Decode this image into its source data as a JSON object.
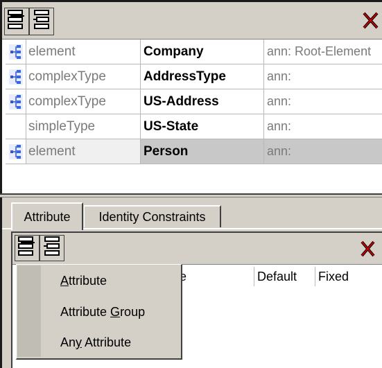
{
  "top_toolbar": {
    "insert_icon": "insert-component-icon",
    "append_icon": "append-component-icon",
    "delete_icon": "delete-x-icon",
    "delete_color": "#cc0000"
  },
  "components": [
    {
      "icon": "element-icon",
      "kind": "element",
      "name": "Company",
      "ann": "ann: Root-Element"
    },
    {
      "icon": "element-icon",
      "kind": "complexType",
      "name": "AddressType",
      "ann": "ann:"
    },
    {
      "icon": "element-icon",
      "kind": "complexType",
      "name": "US-Address",
      "ann": "ann:"
    },
    {
      "icon": "",
      "kind": "simpleType",
      "name": "US-State",
      "ann": "ann:"
    },
    {
      "icon": "element-icon",
      "kind": "element",
      "name": "Person",
      "ann": "ann:",
      "selected": true
    }
  ],
  "tabs": [
    {
      "label": "Attribute",
      "active": true
    },
    {
      "label": "Identity Constraints",
      "active": false
    }
  ],
  "attr_toolbar": {
    "insert_icon": "insert-attribute-icon",
    "append_icon": "append-attribute-icon",
    "delete_icon": "delete-x-icon"
  },
  "attr_headers": {
    "partial": "e",
    "default": "Default",
    "fixed": "Fixed"
  },
  "menu": {
    "items": [
      {
        "pre": "",
        "ul": "A",
        "post": "ttribute"
      },
      {
        "pre": "Attribute ",
        "ul": "G",
        "post": "roup"
      },
      {
        "pre": "An",
        "ul": "y",
        "post": " Attribute"
      }
    ]
  }
}
